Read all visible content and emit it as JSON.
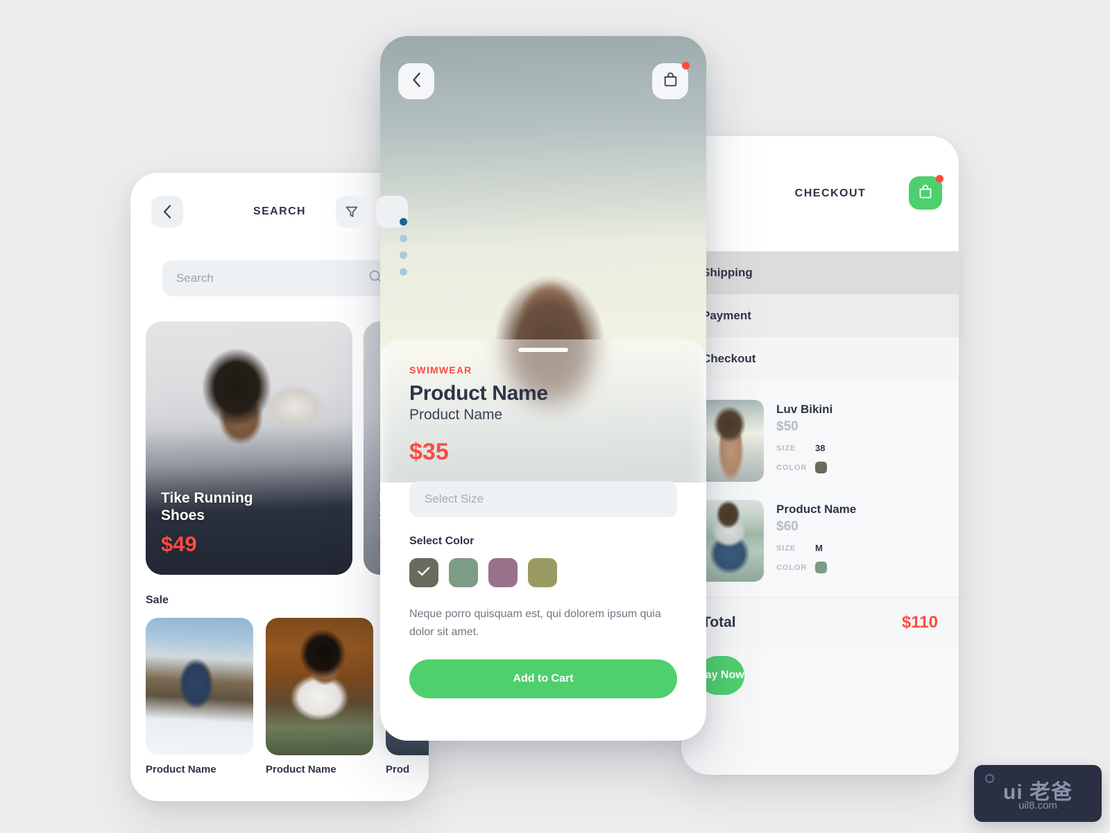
{
  "canvas": {
    "background": "#ededed",
    "accent_green": "#4ed06d",
    "accent_red": "#fb4b42",
    "text_dark": "#2e3446"
  },
  "search_screen": {
    "title": "SEARCH",
    "back_icon": "chevron-left-icon",
    "filter_icon": "filter-funnel-icon",
    "search": {
      "value": "",
      "placeholder": "Search",
      "icon": "magnifier-icon"
    },
    "hero_products": [
      {
        "name": "Tike Running\nShoes",
        "name_line1": "Tike Running",
        "name_line2": "Shoes",
        "price": "$49"
      },
      {
        "name_line1": "L",
        "name_line2": "S",
        "price": "$"
      }
    ],
    "sale_section_title": "Sale",
    "sale_products": [
      {
        "label": "Product Name"
      },
      {
        "label": "Product Name"
      },
      {
        "label": "Prod"
      }
    ]
  },
  "detail_screen": {
    "back_icon": "chevron-left-icon",
    "bag_icon": "shopping-bag-icon",
    "pagination": {
      "count": 4,
      "active_index": 0,
      "active_color": "#15688c",
      "inactive_color": "#a7cade"
    },
    "category": "SWIMWEAR",
    "name": "Product Name",
    "subtitle": "Product Name",
    "price": "$35",
    "size_field": {
      "value": "",
      "placeholder": "Select Size"
    },
    "color_label": "Select Color",
    "colors": [
      {
        "hex": "#6b6a5e",
        "selected": true,
        "check_icon": "check-icon"
      },
      {
        "hex": "#7d9b85",
        "selected": false
      },
      {
        "hex": "#97728a",
        "selected": false
      },
      {
        "hex": "#9a9a63",
        "selected": false
      }
    ],
    "description": "Neque porro quisquam est, qui dolorem ipsum quia dolor sit amet.",
    "cta_label": "Add to Cart"
  },
  "checkout_screen": {
    "title": "CHECKOUT",
    "bag_icon": "shopping-bag-icon",
    "steps": [
      {
        "label": "Shipping"
      },
      {
        "label": "Payment"
      },
      {
        "label": "Checkout"
      }
    ],
    "items": [
      {
        "name": "Luv Bikini",
        "price": "$50",
        "size_key": "SIZE",
        "size_value": "38",
        "color_key": "COLOR",
        "color_hex": "#6b6a5e"
      },
      {
        "name": "Product Name",
        "price": "$60",
        "size_key": "SIZE",
        "size_value": "M",
        "color_key": "COLOR",
        "color_hex": "#7d9b85"
      }
    ],
    "total_label": "Total",
    "total_value": "$110",
    "pay_label": "Pay Now"
  },
  "watermark": {
    "main": "ui 老爸",
    "sub": "uil8.com"
  }
}
